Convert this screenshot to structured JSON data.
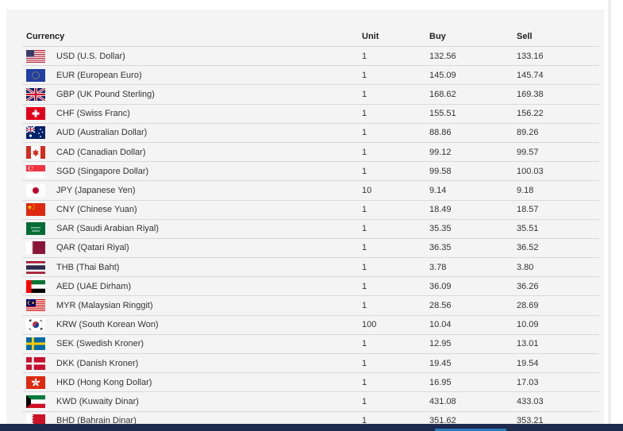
{
  "table": {
    "headers": {
      "currency": "Currency",
      "unit": "Unit",
      "buy": "Buy",
      "sell": "Sell"
    },
    "rows": [
      {
        "flag": "us-flag-icon",
        "currency": "USD (U.S. Dollar)",
        "unit": "1",
        "buy": "132.56",
        "sell": "133.16"
      },
      {
        "flag": "eu-flag-icon",
        "currency": "EUR (European Euro)",
        "unit": "1",
        "buy": "145.09",
        "sell": "145.74"
      },
      {
        "flag": "uk-flag-icon",
        "currency": "GBP (UK Pound Sterling)",
        "unit": "1",
        "buy": "168.62",
        "sell": "169.38"
      },
      {
        "flag": "ch-flag-icon",
        "currency": "CHF (Swiss Franc)",
        "unit": "1",
        "buy": "155.51",
        "sell": "156.22"
      },
      {
        "flag": "au-flag-icon",
        "currency": "AUD (Australian Dollar)",
        "unit": "1",
        "buy": "88.86",
        "sell": "89.26"
      },
      {
        "flag": "ca-flag-icon",
        "currency": "CAD (Canadian Dollar)",
        "unit": "1",
        "buy": "99.12",
        "sell": "99.57"
      },
      {
        "flag": "sg-flag-icon",
        "currency": "SGD (Singapore Dollar)",
        "unit": "1",
        "buy": "99.58",
        "sell": "100.03"
      },
      {
        "flag": "jp-flag-icon",
        "currency": "JPY (Japanese Yen)",
        "unit": "10",
        "buy": "9.14",
        "sell": "9.18"
      },
      {
        "flag": "cn-flag-icon",
        "currency": "CNY (Chinese Yuan)",
        "unit": "1",
        "buy": "18.49",
        "sell": "18.57"
      },
      {
        "flag": "sa-flag-icon",
        "currency": "SAR (Saudi Arabian Riyal)",
        "unit": "1",
        "buy": "35.35",
        "sell": "35.51"
      },
      {
        "flag": "qa-flag-icon",
        "currency": "QAR (Qatari Riyal)",
        "unit": "1",
        "buy": "36.35",
        "sell": "36.52"
      },
      {
        "flag": "th-flag-icon",
        "currency": "THB (Thai Baht)",
        "unit": "1",
        "buy": "3.78",
        "sell": "3.80"
      },
      {
        "flag": "ae-flag-icon",
        "currency": "AED (UAE Dirham)",
        "unit": "1",
        "buy": "36.09",
        "sell": "36.26"
      },
      {
        "flag": "my-flag-icon",
        "currency": "MYR (Malaysian Ringgit)",
        "unit": "1",
        "buy": "28.56",
        "sell": "28.69"
      },
      {
        "flag": "kr-flag-icon",
        "currency": "KRW (South Korean Won)",
        "unit": "100",
        "buy": "10.04",
        "sell": "10.09"
      },
      {
        "flag": "se-flag-icon",
        "currency": "SEK (Swedish Kroner)",
        "unit": "1",
        "buy": "12.95",
        "sell": "13.01"
      },
      {
        "flag": "dk-flag-icon",
        "currency": "DKK (Danish Kroner)",
        "unit": "1",
        "buy": "19.45",
        "sell": "19.54"
      },
      {
        "flag": "hk-flag-icon",
        "currency": "HKD (Hong Kong Dollar)",
        "unit": "1",
        "buy": "16.95",
        "sell": "17.03"
      },
      {
        "flag": "kw-flag-icon",
        "currency": "KWD (Kuwaity Dinar)",
        "unit": "1",
        "buy": "431.08",
        "sell": "433.03"
      },
      {
        "flag": "bh-flag-icon",
        "currency": "BHD (Bahrain Dinar)",
        "unit": "1",
        "buy": "351.62",
        "sell": "353.21"
      }
    ]
  },
  "colors": {
    "panel_bg": "#f4f4f4",
    "row_border": "#d9d9d9",
    "footer_bar": "#1f2a4f",
    "footer_accent": "#2a7ab8"
  }
}
